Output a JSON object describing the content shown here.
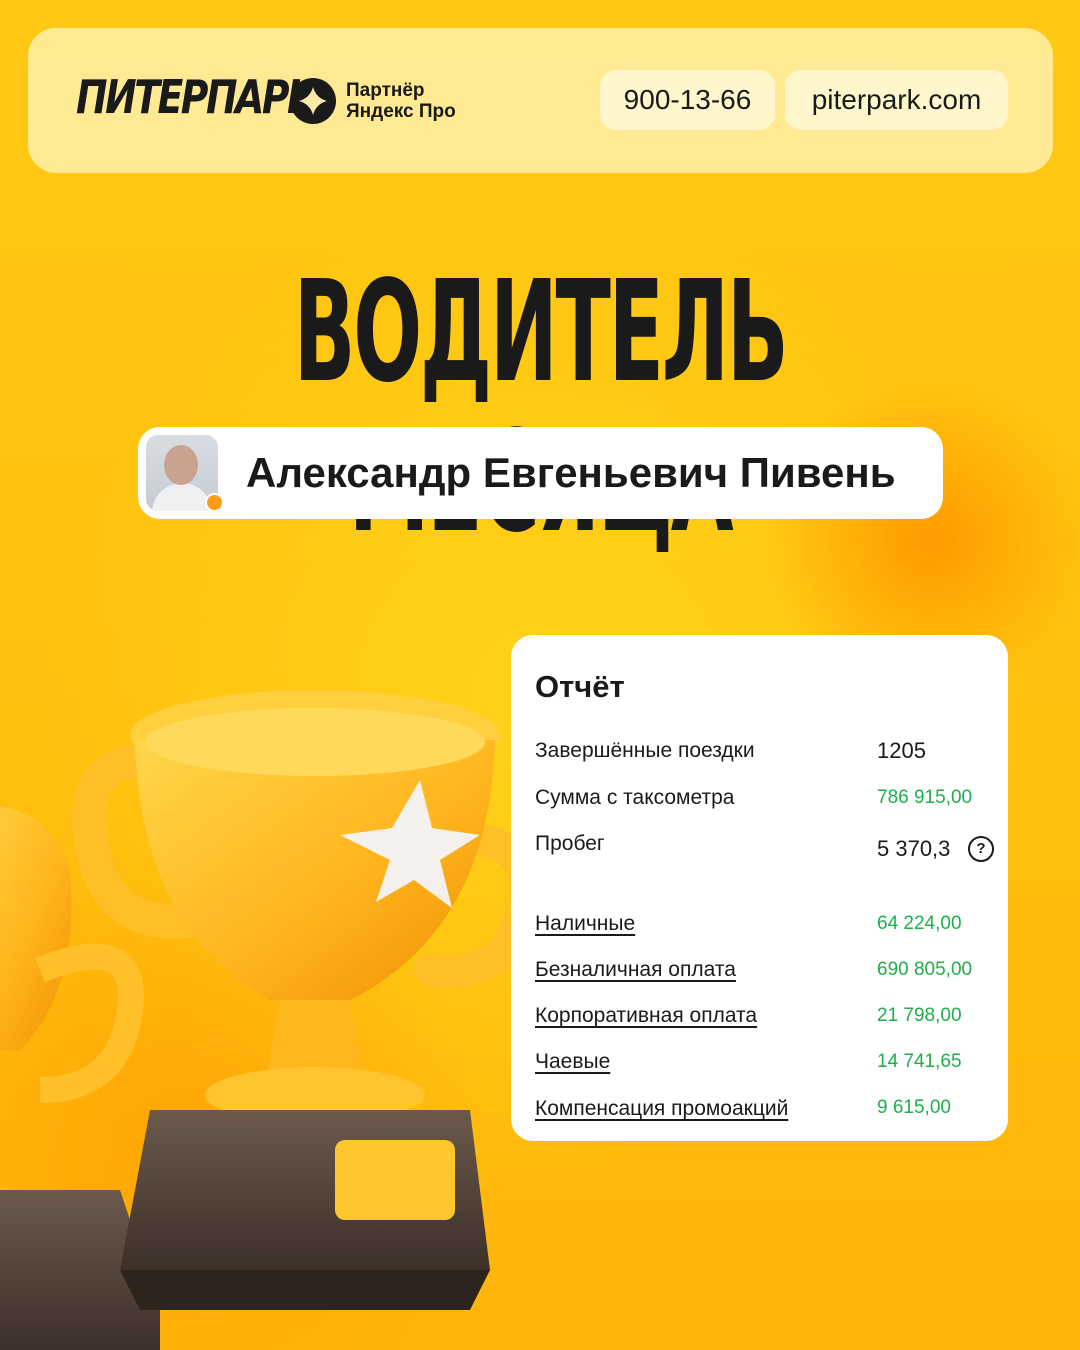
{
  "header": {
    "logo": "ПИТЕРПАРК",
    "partner_line1": "Партнёр",
    "partner_line2": "Яндекс Про",
    "phone": "900-13-66",
    "site": "piterpark.com"
  },
  "headline": "ВОДИТЕЛЬ МЕСЯЦА",
  "driver": {
    "name": "Александр Евгеньевич Пивень"
  },
  "report": {
    "title": "Отчёт",
    "rows": [
      {
        "label": "Завершённые поездки",
        "value": "1205"
      },
      {
        "label": "Сумма с таксометра",
        "value": "786 915,00"
      },
      {
        "label": "Пробег",
        "value": "5 370,3"
      },
      {
        "label": "Наличные",
        "value": "64 224,00"
      },
      {
        "label": "Безналичная оплата",
        "value": "690 805,00"
      },
      {
        "label": "Корпоративная оплата",
        "value": "21 798,00"
      },
      {
        "label": "Чаевые",
        "value": "14 741,65"
      },
      {
        "label": "Компенсация промоакций",
        "value": "9 615,00"
      }
    ],
    "help_glyph": "?"
  },
  "colors": {
    "background": "#ffc20e",
    "money": "#1fae4b",
    "text": "#1a1a1a"
  },
  "icons": [
    "yandex-pro-icon",
    "help-icon",
    "trophy-illustration"
  ]
}
